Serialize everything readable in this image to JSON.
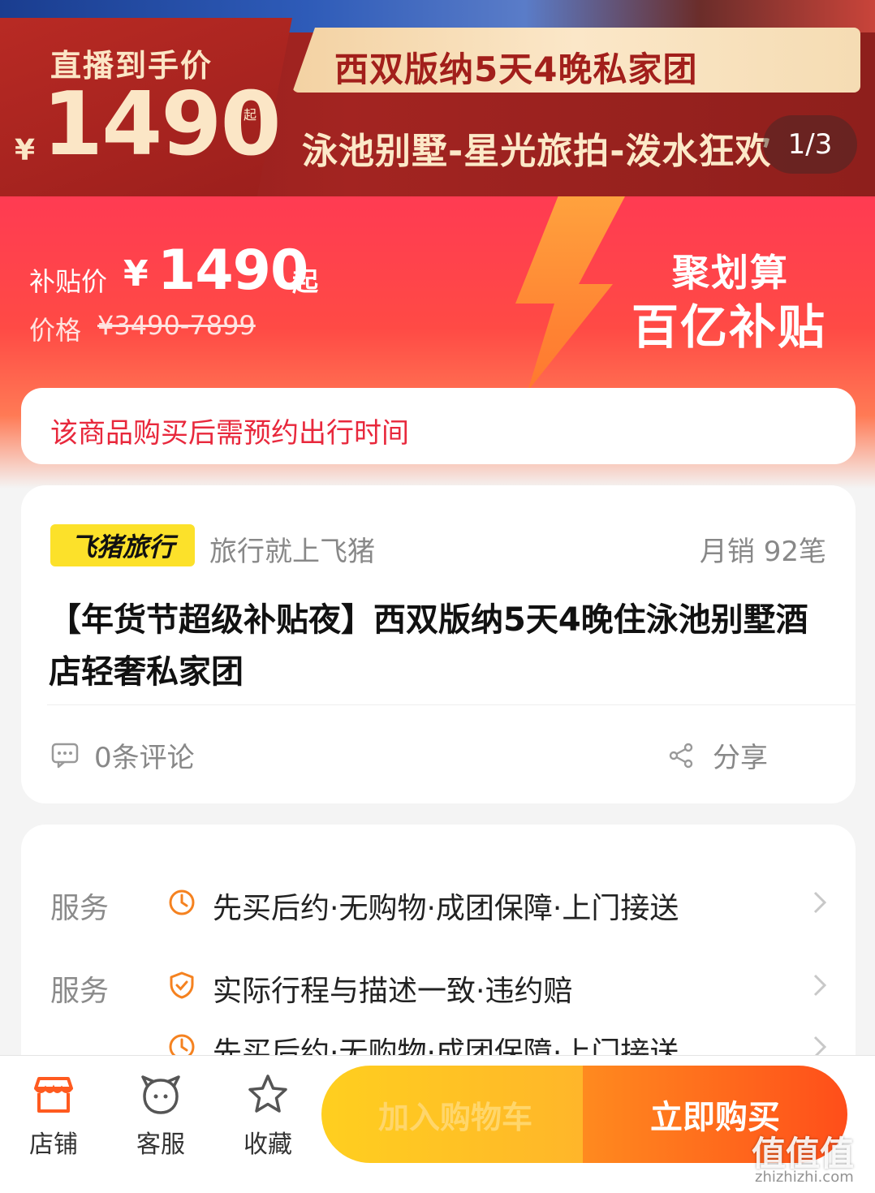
{
  "hero": {
    "live_label": "直播到手价",
    "yen": "¥",
    "price": "1490",
    "qi": "起",
    "title": "西双版纳5天4晚私家团",
    "subtitle": "泳池别墅-星光旅拍-泼水狂欢",
    "counter": "1/3"
  },
  "subsidy": {
    "label": "补贴价",
    "yen": "¥",
    "price": "1490",
    "qi": "起",
    "original_label": "价格",
    "original_price": "¥3490-7899",
    "badge_line1": "聚划算",
    "badge_line2": "百亿补贴"
  },
  "notice": {
    "text": "该商品购买后需预约出行时间"
  },
  "product": {
    "brand": "飞猪旅行",
    "slogan": "旅行就上飞猪",
    "sales": "月销 92笔",
    "title": "【年货节超级补贴夜】西双版纳5天4晚住泳池别墅酒店轻奢私家团",
    "reviews": "0条评论",
    "share": "分享"
  },
  "services": [
    {
      "label": "服务",
      "icon": "clock-icon",
      "text": "先买后约·无购物·成团保障·上门接送"
    },
    {
      "label": "服务",
      "icon": "shield-icon",
      "text": "实际行程与描述一致·违约赔"
    },
    {
      "label": "",
      "icon": "clock-icon",
      "text": "先买后约·无购物·成团保障·上门接送"
    }
  ],
  "bottom": {
    "store": "店铺",
    "service": "客服",
    "favorite": "收藏",
    "add_cart": "加入购物车",
    "buy_now": "立即购买"
  },
  "watermark": {
    "text": "值值值",
    "url": "zhizhizhi.com"
  },
  "colors": {
    "accent": "#ff5a1f",
    "subsidy_red": "#ff3b52",
    "brand_yellow": "#fce12a",
    "icon_orange": "#f58220"
  }
}
